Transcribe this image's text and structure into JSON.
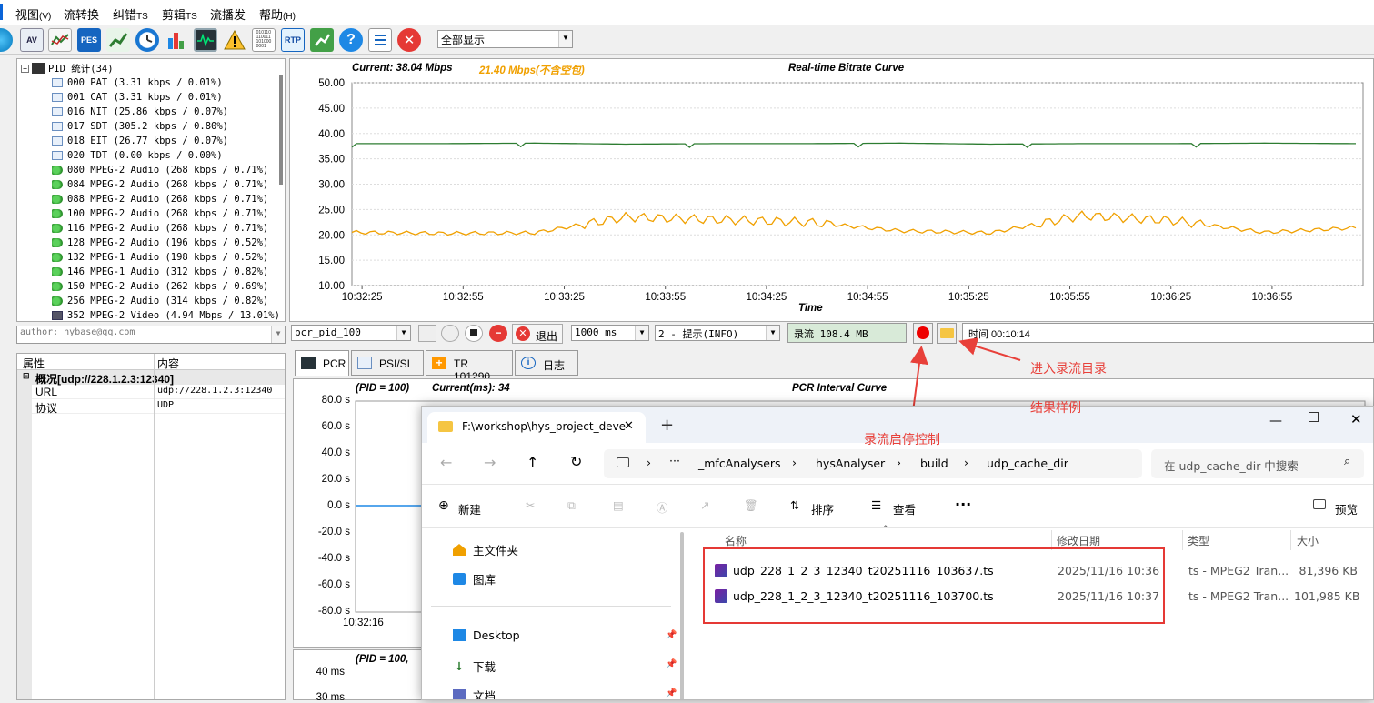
{
  "menu": [
    {
      "label": "视图",
      "key": "(V)"
    },
    {
      "label": "流转换",
      "key": ""
    },
    {
      "label": "纠错",
      "key": "TS"
    },
    {
      "label": "剪辑",
      "key": "TS"
    },
    {
      "label": "流播发",
      "key": ""
    },
    {
      "label": "帮助",
      "key": "(H)"
    }
  ],
  "toolbar": {
    "icons": [
      "globe-icon",
      "av-icon",
      "graph-icon",
      "pes-icon",
      "trend-icon",
      "clock-icon",
      "bar-chart-icon",
      "monitor-icon",
      "warning-icon",
      "binary-icon",
      "rtp-icon",
      "export-icon",
      "help-icon",
      "list-icon",
      "close-icon"
    ],
    "labels": {
      "av": "AV",
      "pes": "PES",
      "rtp": "RTP",
      "binary": "010110\n110011\n101000\n0001"
    },
    "view_select": "全部显示"
  },
  "tree": {
    "root": "PID 统计(34)",
    "items": [
      {
        "icon": "table",
        "text": "000 PAT (3.31 kbps / 0.01%)"
      },
      {
        "icon": "table",
        "text": "001 CAT (3.31 kbps / 0.01%)"
      },
      {
        "icon": "table",
        "text": "016 NIT (25.86 kbps / 0.07%)"
      },
      {
        "icon": "table",
        "text": "017 SDT (305.2 kbps / 0.80%)"
      },
      {
        "icon": "table",
        "text": "018 EIT (26.77 kbps / 0.07%)"
      },
      {
        "icon": "table",
        "text": "020 TDT (0.00 kbps / 0.00%)"
      },
      {
        "icon": "audio",
        "text": "080 MPEG-2 Audio (268 kbps / 0.71%)"
      },
      {
        "icon": "audio",
        "text": "084 MPEG-2 Audio (268 kbps / 0.71%)"
      },
      {
        "icon": "audio",
        "text": "088 MPEG-2 Audio (268 kbps / 0.71%)"
      },
      {
        "icon": "audio",
        "text": "100 MPEG-2 Audio (268 kbps / 0.71%)"
      },
      {
        "icon": "audio",
        "text": "116 MPEG-2 Audio (268 kbps / 0.71%)"
      },
      {
        "icon": "audio",
        "text": "128 MPEG-2 Audio (196 kbps / 0.52%)"
      },
      {
        "icon": "audio",
        "text": "132 MPEG-1 Audio (198 kbps / 0.52%)"
      },
      {
        "icon": "audio",
        "text": "146 MPEG-1 Audio (312 kbps / 0.82%)"
      },
      {
        "icon": "audio",
        "text": "150 MPEG-2 Audio (262 kbps / 0.69%)"
      },
      {
        "icon": "audio",
        "text": "256 MPEG-2 Audio (314 kbps / 0.82%)"
      },
      {
        "icon": "video",
        "text": "352 MPEG-2 Video (4.94 Mbps / 13.01%)"
      }
    ]
  },
  "author_field": "author: hybase@qq.com",
  "props": {
    "col1": "属性",
    "col2": "内容",
    "group": "概况[udp://228.1.2.3:12340]",
    "rows": [
      {
        "k": "URL",
        "v": "udp://228.1.2.3:12340"
      },
      {
        "k": "协议",
        "v": "UDP"
      }
    ]
  },
  "bitrate_chart": {
    "current": "Current: 38.04 Mbps",
    "secondary": "21.40 Mbps(不含空包)",
    "title": "Real-time Bitrate Curve",
    "xlabel": "Time",
    "colors": {
      "total": "#2e7d32",
      "payload": "#f0a000"
    }
  },
  "controls": {
    "pid_select": "pcr_pid_100",
    "exit_label": "退出",
    "interval_select": "1000 ms",
    "log_select": "2 - 提示(INFO)",
    "record_label": "录流 108.4 MB",
    "time_label": "时间 00:10:14"
  },
  "tabs": [
    {
      "label": "PCR",
      "icon": "monitor-icon"
    },
    {
      "label": "PSI/SI",
      "icon": "table-icon"
    },
    {
      "label": "TR 101290",
      "icon": "plus-icon"
    },
    {
      "label": "日志",
      "icon": "info-icon"
    }
  ],
  "pcr_chart": {
    "header_pid": "(PID = 100)",
    "current": "Current(ms): 34",
    "title": "PCR Interval Curve",
    "yticks": [
      "80.0 s",
      "60.0 s",
      "40.0 s",
      "20.0 s",
      "0.0 s",
      "-20.0 s",
      "-40.0 s",
      "-60.0 s",
      "-80.0 s"
    ],
    "xtick": "10:32:16"
  },
  "bottom_chart": {
    "header_pid": "(PID = 100,",
    "yticks": [
      "40 ms",
      "30 ms"
    ]
  },
  "annotations": {
    "enter_dir": "进入录流目录",
    "result_example": "结果样例",
    "record_control": "录流启停控制"
  },
  "explorer": {
    "tab_title": "F:\\workshop\\hys_project_deve",
    "breadcrumb": [
      "_mfcAnalysers",
      "hysAnalyser",
      "build",
      "udp_cache_dir"
    ],
    "search_placeholder": "在 udp_cache_dir 中搜索",
    "cmd": {
      "new": "新建",
      "sort": "排序",
      "view": "查看",
      "preview": "预览"
    },
    "nav": [
      {
        "label": "主文件夹",
        "icon": "home-icon"
      },
      {
        "label": "图库",
        "icon": "gallery-icon"
      },
      {
        "label": "Desktop",
        "icon": "desktop-icon"
      },
      {
        "label": "下载",
        "icon": "download-icon"
      },
      {
        "label": "文档",
        "icon": "document-icon"
      }
    ],
    "columns": {
      "name": "名称",
      "date": "修改日期",
      "type": "类型",
      "size": "大小"
    },
    "files": [
      {
        "name": "udp_228_1_2_3_12340_t20251116_103637.ts",
        "date": "2025/11/16 10:36",
        "type": "ts - MPEG2 Tran...",
        "size": "81,396 KB"
      },
      {
        "name": "udp_228_1_2_3_12340_t20251116_103700.ts",
        "date": "2025/11/16 10:37",
        "type": "ts - MPEG2 Tran...",
        "size": "101,985 KB"
      }
    ]
  },
  "chart_data": [
    {
      "type": "line",
      "title": "Real-time Bitrate Curve",
      "xlabel": "Time",
      "ylabel": "",
      "ylim": [
        10,
        50
      ],
      "yticks": [
        "50.00",
        "45.00",
        "40.00",
        "35.00",
        "30.00",
        "25.00",
        "20.00",
        "15.00",
        "10.00"
      ],
      "xticks": [
        "10:32:25",
        "10:32:55",
        "10:33:25",
        "10:33:55",
        "10:34:25",
        "10:34:55",
        "10:35:25",
        "10:35:55",
        "10:36:25",
        "10:36:55"
      ],
      "grid": true,
      "series": [
        {
          "name": "Current: 38.04 Mbps",
          "values": [
            38.0,
            38.0,
            38.1,
            37.9,
            38.0,
            38.0,
            38.1,
            37.9,
            38.0,
            38.0,
            38.1,
            38.0
          ]
        },
        {
          "name": "21.40 Mbps(不含空包)",
          "values": [
            20.5,
            20.3,
            20.4,
            23.5,
            23.0,
            22.5,
            20.8,
            20.4,
            23.8,
            22.8,
            20.5,
            21.4
          ]
        }
      ]
    }
  ]
}
